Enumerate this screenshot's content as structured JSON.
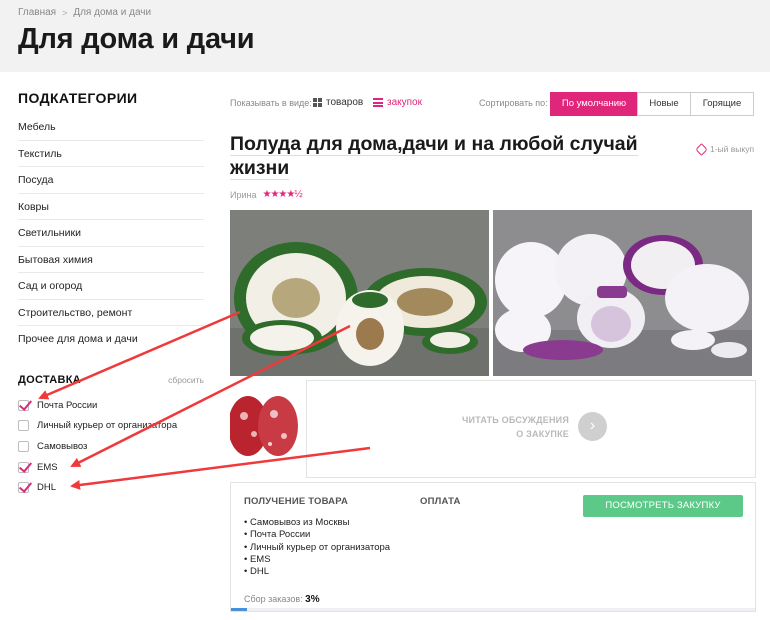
{
  "breadcrumb": {
    "home": "Главная",
    "sep": ">",
    "current": "Для дома и дачи"
  },
  "page_title": "Для дома и дачи",
  "sidebar": {
    "title": "ПОДКАТЕГОРИИ",
    "items": [
      {
        "label": "Мебель"
      },
      {
        "label": "Текстиль"
      },
      {
        "label": "Посуда"
      },
      {
        "label": "Ковры"
      },
      {
        "label": "Светильники"
      },
      {
        "label": "Бытовая химия"
      },
      {
        "label": "Сад и огород"
      },
      {
        "label": "Строительство, ремонт"
      },
      {
        "label": "Прочее для дома и дачи"
      }
    ]
  },
  "delivery": {
    "title": "ДОСТАВКА",
    "reset": "сбросить",
    "options": [
      {
        "label": "Почта России",
        "checked": true
      },
      {
        "label": "Личный курьер от организатора",
        "checked": false
      },
      {
        "label": "Самовывоз",
        "checked": false
      },
      {
        "label": "EMS",
        "checked": true
      },
      {
        "label": "DHL",
        "checked": true
      }
    ]
  },
  "toolbar": {
    "view_label": "Показывать в виде:",
    "view_goods": "товаров",
    "view_purchase": "закупок",
    "sort_label": "Сортировать по:",
    "sort_options": [
      {
        "label": "По умолчанию",
        "active": true
      },
      {
        "label": "Новые",
        "active": false
      },
      {
        "label": "Горящие",
        "active": false
      }
    ]
  },
  "product": {
    "title": "Полуда для дома,дачи и на любой случай жизни",
    "badge": "1-ый выкуп",
    "author": "Ирина",
    "rating": 4.5,
    "stars": "★★★★½"
  },
  "discussion": {
    "line1": "ЧИТАТЬ ОБСУЖДЕНИЯ",
    "line2": "О ЗАКУПКЕ",
    "arrow": "›"
  },
  "info": {
    "receive_title": "ПОЛУЧЕНИЕ ТОВАРА",
    "payment_title": "ОПЛАТА",
    "view_button": "ПОСМОТРЕТЬ ЗАКУПКУ",
    "receive_options": [
      "Самовывоз из Москвы",
      "Почта России",
      "Личный курьер от организатора",
      "EMS",
      "DHL"
    ],
    "collect_label": "Сбор заказов:",
    "collect_value": "3%",
    "progress": 0.03
  },
  "colors": {
    "accent": "#e0267a",
    "button_green": "#5dc989",
    "progress": "#4a90d9",
    "annotation_arrow": "#f0393b"
  }
}
